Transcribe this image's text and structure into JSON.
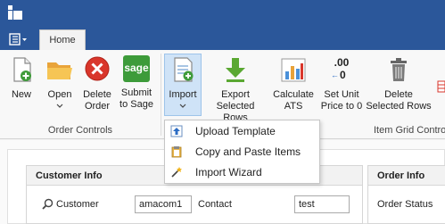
{
  "ribbon": {
    "tab_home": "Home",
    "buttons": {
      "new": "New",
      "open": "Open",
      "delete_order_l1": "Delete",
      "delete_order_l2": "Order",
      "submit_sage_l1": "Submit",
      "submit_sage_l2": "to Sage",
      "import": "Import",
      "export_l1": "Export",
      "export_l2": "Selected Rows",
      "calc_l1": "Calculate",
      "calc_l2": "ATS",
      "setunit_l1": "Set Unit",
      "setunit_l2": "Price to 0",
      "delete_rows_l1": "Delete",
      "delete_rows_l2": "Selected Rows"
    },
    "groups": {
      "order_controls": "Order Controls",
      "item_grid_controls": "Item Grid Contro"
    },
    "sage_logo_text": "sage",
    "decimal_icon_top": ".00",
    "decimal_icon_bottom": "0"
  },
  "import_menu": {
    "items": [
      {
        "label": "Upload Template"
      },
      {
        "label": "Copy and Paste Items"
      },
      {
        "label": "Import Wizard"
      }
    ]
  },
  "customer_info": {
    "header": "Customer Info",
    "customer_label": "Customer",
    "customer_value": "amacom1",
    "contact_label": "Contact",
    "contact_value": "test"
  },
  "order_info": {
    "header": "Order Info",
    "order_status_label": "Order Status"
  },
  "colors": {
    "title_bar": "#2b579a",
    "highlight": "#cfe3f7",
    "delete_red": "#d9362b",
    "export_green": "#5aa832",
    "sage_green": "#3d9b3a"
  }
}
